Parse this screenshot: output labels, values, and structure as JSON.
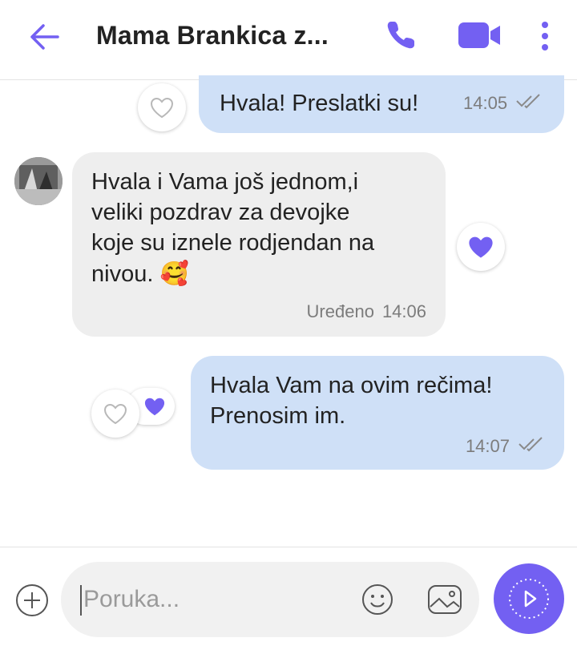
{
  "header": {
    "title": "Mama Brankica z...",
    "back_icon": "back-arrow-icon",
    "call_icon": "phone-icon",
    "video_icon": "video-camera-icon",
    "more_icon": "more-vertical-icon"
  },
  "colors": {
    "accent": "#7360f2",
    "outgoing_bubble": "#cfe0f7",
    "incoming_bubble": "#eeeeee"
  },
  "messages": [
    {
      "direction": "outgoing",
      "text": "Hvala! Preslatki su!",
      "time": "14:05",
      "status_icon": "double-check-icon",
      "reaction": "heart-outline"
    },
    {
      "direction": "incoming",
      "lines": [
        "Hvala i Vama još jednom,i",
        "veliki pozdrav za devojke",
        "koje su iznele rodjendan na",
        "nivou."
      ],
      "emoji": "🥰",
      "edited_label": "Uređeno",
      "time": "14:06",
      "reaction": "heart-filled"
    },
    {
      "direction": "outgoing",
      "lines": [
        "Hvala Vam na ovim rečima!",
        "Prenosim im."
      ],
      "time": "14:07",
      "status_icon": "double-check-icon",
      "reaction": "heart-outline-with-filled"
    }
  ],
  "composer": {
    "placeholder": "Poruka...",
    "plus_icon": "plus-circle-icon",
    "emoji_icon": "smiley-icon",
    "gallery_icon": "gallery-icon",
    "send_icon": "send-icon"
  }
}
